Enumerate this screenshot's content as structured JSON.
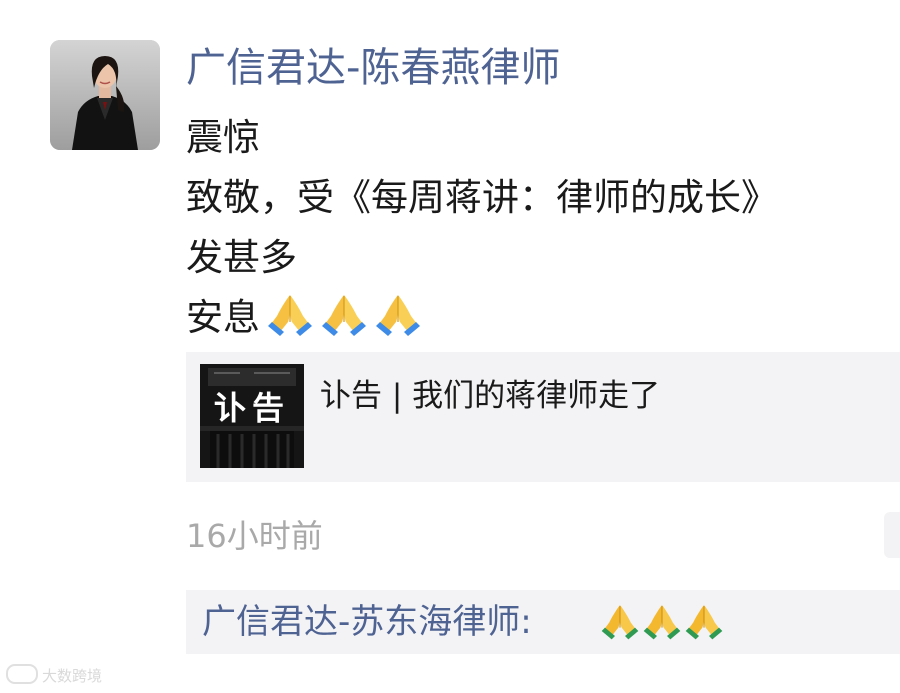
{
  "moment": {
    "author": "广信君达-陈春燕律师",
    "lines": [
      "震惊",
      "致敬，受《每周蒋讲：律师的成长》",
      "发甚多",
      "安息"
    ],
    "emojis": [
      "folded-hands",
      "folded-hands",
      "folded-hands"
    ],
    "shared_link": {
      "thumbnail_text": "讣告",
      "title": "讣告 | 我们的蒋律师走了"
    },
    "time": "16小时前",
    "comment": {
      "author": "广信君达-苏东海律师:",
      "emojis": [
        "folded-hands",
        "folded-hands",
        "folded-hands"
      ]
    }
  },
  "watermark": {
    "text": "大数跨境"
  },
  "colors": {
    "name_link": "#4f6393",
    "body_text": "#1a1a1a",
    "timestamp": "#a9a9a9",
    "card_bg": "#f3f3f5",
    "emoji_yellow": "#f6c142",
    "emoji_cuff": "#3d8be6"
  }
}
